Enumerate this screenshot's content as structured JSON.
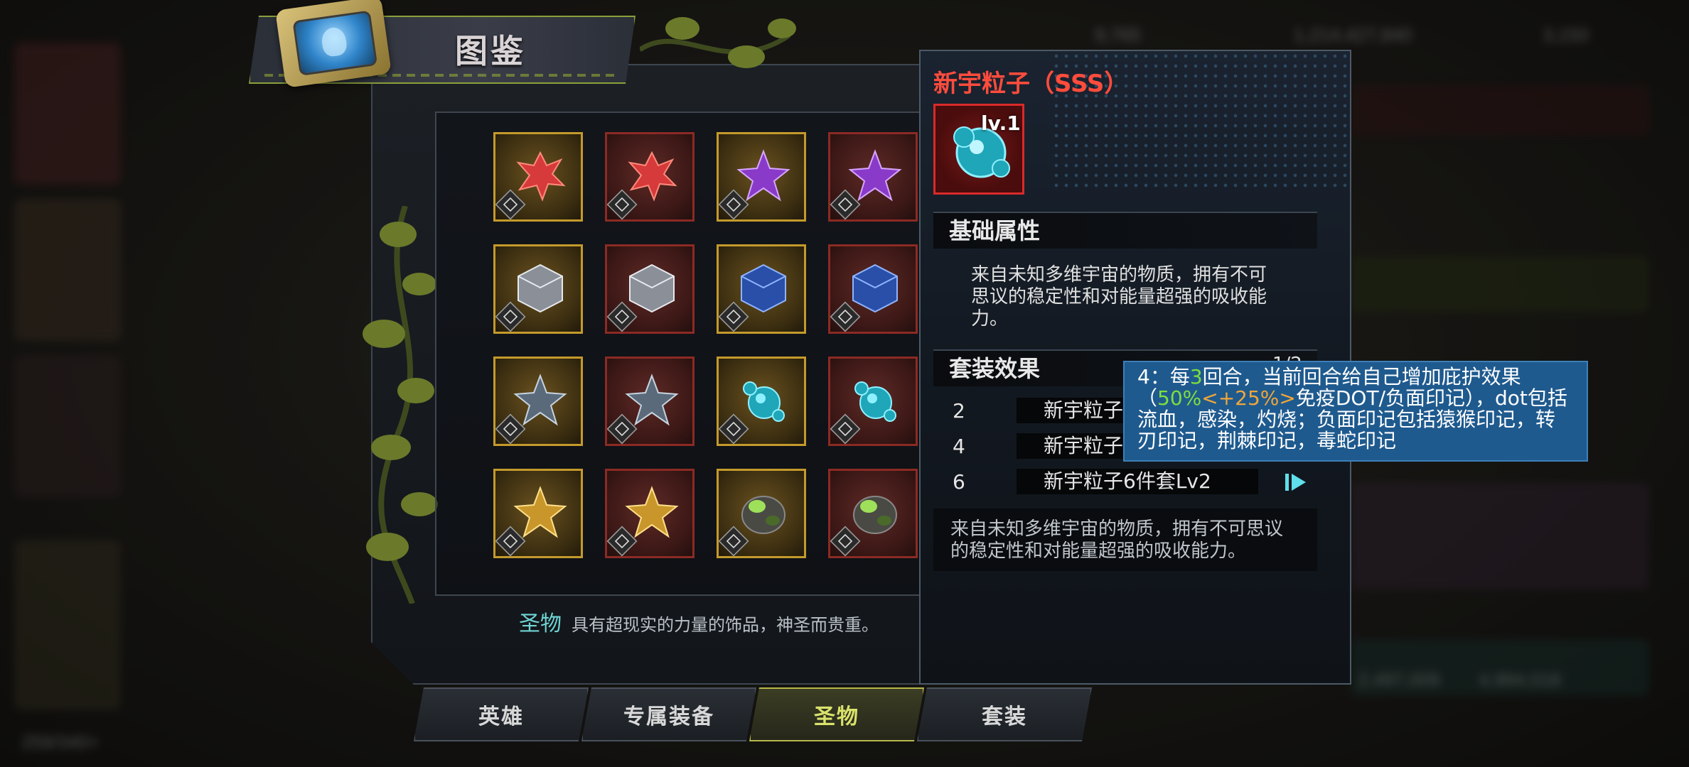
{
  "header": {
    "title": "图鉴"
  },
  "background": {
    "numbers": [
      "9,765",
      "1,214,427,840",
      "3,150",
      "2,497,009",
      "4,994,018",
      "259/340+"
    ]
  },
  "grid": {
    "rows": [
      [
        {
          "frame": "gold",
          "gem": "red-coral"
        },
        {
          "frame": "red",
          "gem": "red-coral"
        },
        {
          "frame": "gold",
          "gem": "purple-crystal"
        },
        {
          "frame": "red",
          "gem": "purple-crystal"
        }
      ],
      [
        {
          "frame": "gold",
          "gem": "silver-cube"
        },
        {
          "frame": "red",
          "gem": "silver-cube"
        },
        {
          "frame": "gold",
          "gem": "blue-cube"
        },
        {
          "frame": "red",
          "gem": "blue-cube"
        }
      ],
      [
        {
          "frame": "gold",
          "gem": "gray-star"
        },
        {
          "frame": "red",
          "gem": "gray-star"
        },
        {
          "frame": "gold",
          "gem": "cyan-orb"
        },
        {
          "frame": "red",
          "gem": "cyan-orb"
        }
      ],
      [
        {
          "frame": "gold",
          "gem": "gold-star"
        },
        {
          "frame": "red",
          "gem": "gold-star"
        },
        {
          "frame": "gold",
          "gem": "green-rock"
        },
        {
          "frame": "red",
          "gem": "green-rock"
        }
      ]
    ]
  },
  "footer": {
    "category": "圣物",
    "description": "具有超现实的力量的饰品，神圣而贵重。"
  },
  "tabs": [
    {
      "label": "英雄",
      "active": false
    },
    {
      "label": "专属装备",
      "active": false
    },
    {
      "label": "圣物",
      "active": true
    },
    {
      "label": "套装",
      "active": false
    }
  ],
  "detail": {
    "title": "新宇粒子（SSS）",
    "level": "lv.1",
    "basic_section": "基础属性",
    "basic_desc": "来自未知多维宇宙的物质，拥有不可思议的稳定性和对能量超强的吸收能力。",
    "set_section": "套装效果",
    "page": "1/2",
    "set_rows": [
      {
        "num": "2",
        "name": "新宇粒子"
      },
      {
        "num": "4",
        "name": "新宇粒子"
      },
      {
        "num": "6",
        "name": "新宇粒子6件套Lv2"
      }
    ],
    "bottom_desc": "来自未知多维宇宙的物质，拥有不可思议的稳定性和对能量超强的吸收能力。"
  },
  "tooltip": {
    "p1": "4：每",
    "n1": "3",
    "p2": "回合，当前回合给自己增加庇护效果（",
    "pct": "50%",
    "bonus": "<+25%>",
    "p3": "免疫DOT/负面印记），dot包括流血，感染，灼烧；负面印记包括猿猴印记，转刃印记，荆棘印记，毒蛇印记"
  },
  "colors": {
    "title_red": "#ff4c3d",
    "gold_frame": "#c49a2c",
    "red_frame": "#8c2a24",
    "tooltip_bg": "#1f5a8e",
    "active_tab": "#d9e26b"
  }
}
